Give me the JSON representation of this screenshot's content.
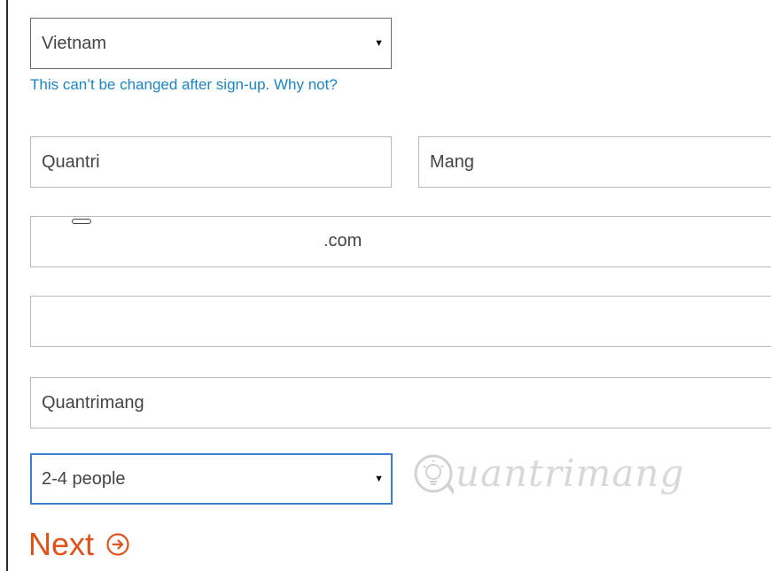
{
  "form": {
    "country": {
      "value": "Vietnam",
      "help_link": "This can’t be changed after sign-up. Why not?"
    },
    "first_name": {
      "value": "Quantri"
    },
    "last_name": {
      "value": "Mang"
    },
    "email": {
      "value": ".com"
    },
    "phone": {
      "value": ""
    },
    "company": {
      "value": "Quantrimang"
    },
    "company_size": {
      "value": "2-4 people"
    },
    "next_label": "Next"
  },
  "watermark": {
    "text": "uantrimang"
  },
  "icons": {
    "dropdown": "caret-down-icon",
    "next": "circle-arrow-right-icon",
    "watermark": "lightbulb-logo-icon"
  },
  "colors": {
    "link": "#1a85c4",
    "accent": "#e05219",
    "focus_border": "#3a7fd0",
    "border": "#b9b9b9"
  }
}
